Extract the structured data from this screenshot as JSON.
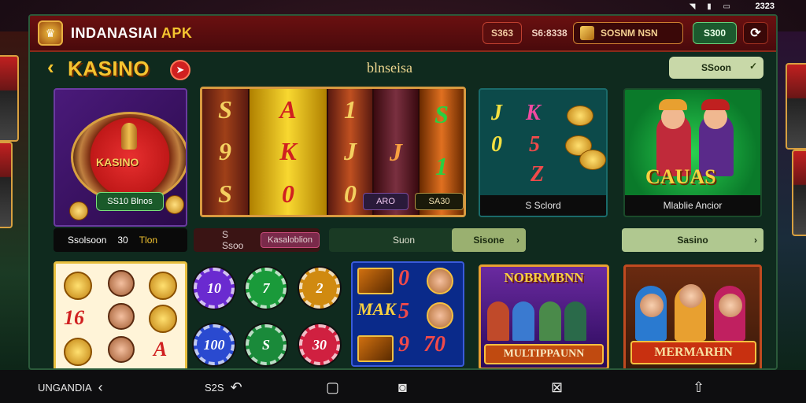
{
  "status_bar": {
    "time": "2323",
    "icons": [
      "wifi-icon",
      "signal-icon",
      "battery-icon"
    ]
  },
  "topbar": {
    "brand_name": "INDANASIAI",
    "brand_suffix": "APK",
    "pill1": "S363",
    "pill2": "S6:8338",
    "pill3": "SOSNM NSN",
    "pill4": "S300",
    "refresh_icon": "refresh-icon"
  },
  "nav": {
    "title": "KASINO",
    "center_label": "blnseisa",
    "search_label": "SSoon"
  },
  "cards": {
    "roulette": {
      "wheel_label": "KASINO",
      "chip_label": "SS10 Blnos"
    },
    "slot": {
      "badge_left": "ARO",
      "badge_right": "SA30"
    },
    "teal": {
      "caption": "S Sclord"
    },
    "players": {
      "banner": "CAUAS",
      "caption": "Mlablie Ancior"
    },
    "multiplayer": {
      "header": "NOBRMBNN",
      "footer": "MULTIPPAUNN"
    },
    "family": {
      "footer": "MERMARHN"
    },
    "blue": {
      "mid_text": "MAK"
    }
  },
  "row_bar": {
    "left_a": "Ssolsoon",
    "left_b": "30",
    "left_c": "Tlon",
    "mid_a": "S Ssoo",
    "mid_tag": "Kasaloblion",
    "center": "Suon",
    "center_button": "Sisone",
    "right": "Sasino"
  },
  "reels": {
    "r1": [
      "S",
      "9",
      "S"
    ],
    "r2": [
      "A",
      "K",
      "0"
    ],
    "r3": [
      "1",
      "J",
      "0"
    ],
    "r4": [
      "",
      "J",
      ""
    ],
    "r5": [
      "S",
      "1",
      ""
    ]
  },
  "teal_symbols": [
    "J",
    "K",
    "0",
    "5",
    "Z"
  ],
  "yellow_card": {
    "n1": "16",
    "n2": "A"
  },
  "chips": [
    {
      "label": "10",
      "color": "#6a2ad0"
    },
    {
      "label": "7",
      "color": "#1a9a3a"
    },
    {
      "label": "2",
      "color": "#d08a10"
    },
    {
      "label": "100",
      "color": "#2a4ad0"
    },
    {
      "label": "S",
      "color": "#1a8a3a"
    },
    {
      "label": "30",
      "color": "#d02040"
    }
  ],
  "blue_card_digits": [
    "0",
    "5",
    "9",
    "70"
  ],
  "bottom_nav": {
    "left": "UNGANDIA",
    "back_label": "S2S",
    "items": [
      "back-icon",
      "recent-icon",
      "home-icon",
      "search-icon",
      "wallet-icon",
      "upload-icon"
    ]
  }
}
